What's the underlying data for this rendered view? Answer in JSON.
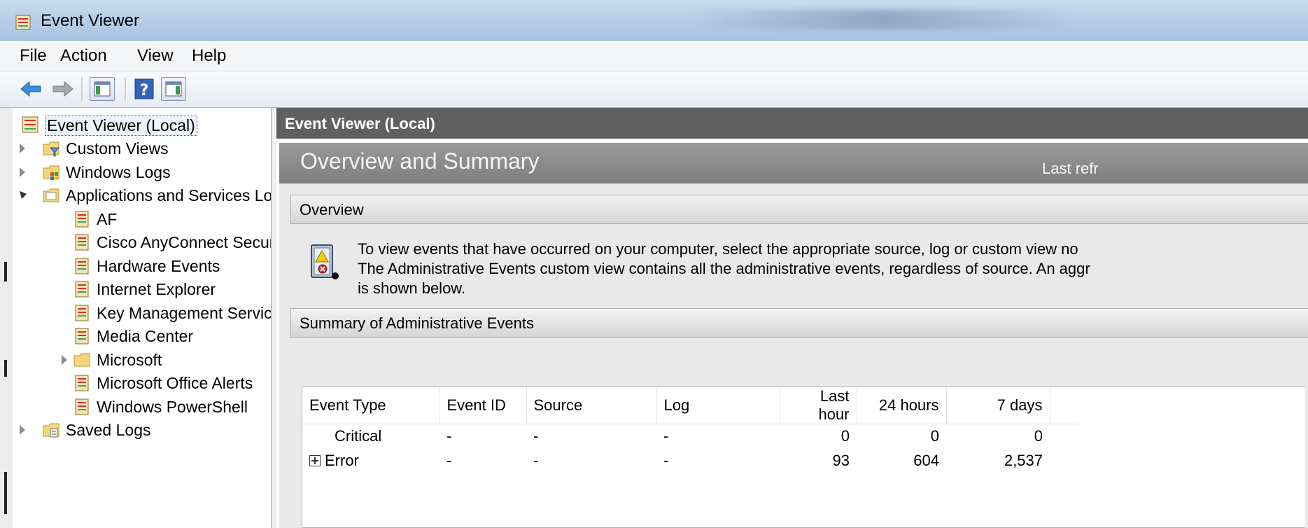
{
  "window": {
    "title": "Event Viewer"
  },
  "menu": {
    "items": [
      "File",
      "Action",
      "View",
      "Help"
    ]
  },
  "tree": {
    "root": "Event Viewer (Local)",
    "items": [
      {
        "label": "Custom Views",
        "indent": 1,
        "arrow": "collapsed",
        "icon": "folder-filter-icon"
      },
      {
        "label": "Windows Logs",
        "indent": 1,
        "arrow": "collapsed",
        "icon": "folder-windows-icon"
      },
      {
        "label": "Applications and Services Lo",
        "indent": 1,
        "arrow": "expanded",
        "icon": "folder-open-icon"
      },
      {
        "label": "AF",
        "indent": 2,
        "arrow": "none",
        "icon": "log-icon"
      },
      {
        "label": "Cisco AnyConnect Secur",
        "indent": 2,
        "arrow": "none",
        "icon": "log-icon"
      },
      {
        "label": "Hardware Events",
        "indent": 2,
        "arrow": "none",
        "icon": "log-icon"
      },
      {
        "label": "Internet Explorer",
        "indent": 2,
        "arrow": "none",
        "icon": "log-icon"
      },
      {
        "label": "Key Management Service",
        "indent": 2,
        "arrow": "none",
        "icon": "log-icon"
      },
      {
        "label": "Media Center",
        "indent": 2,
        "arrow": "none",
        "icon": "log-icon"
      },
      {
        "label": "Microsoft",
        "indent": 2,
        "arrow": "collapsed",
        "icon": "folder-icon"
      },
      {
        "label": "Microsoft Office Alerts",
        "indent": 2,
        "arrow": "none",
        "icon": "log-icon"
      },
      {
        "label": "Windows PowerShell",
        "indent": 2,
        "arrow": "none",
        "icon": "log-icon"
      },
      {
        "label": "Saved Logs",
        "indent": 1,
        "arrow": "collapsed",
        "icon": "folder-saved-icon"
      }
    ]
  },
  "main": {
    "header": "Event Viewer (Local)",
    "banner_title": "Overview and Summary",
    "last_refreshed": "Last refr",
    "overview_title": "Overview",
    "overview_lines": [
      "To view events that have occurred on your computer, select the appropriate source, log or custom view no",
      "The Administrative Events custom view contains all the administrative events, regardless of source. An aggr",
      "is shown below."
    ],
    "summary_title": "Summary of Administrative Events",
    "table": {
      "columns": [
        "Event Type",
        "Event ID",
        "Source",
        "Log",
        "Last hour",
        "24 hours",
        "7 days"
      ],
      "rows": [
        {
          "type": "Critical",
          "expandable": false,
          "event_id": "-",
          "source": "-",
          "log": "-",
          "last_hour": "0",
          "h24": "0",
          "d7": "0"
        },
        {
          "type": "Error",
          "expandable": true,
          "event_id": "-",
          "source": "-",
          "log": "-",
          "last_hour": "93",
          "h24": "604",
          "d7": "2,537"
        }
      ]
    }
  },
  "colors": {
    "title_bar": "#b8cfe8",
    "main_header": "#606060",
    "banner": "#8c8c8c",
    "content_bg": "#e9e9e9"
  }
}
